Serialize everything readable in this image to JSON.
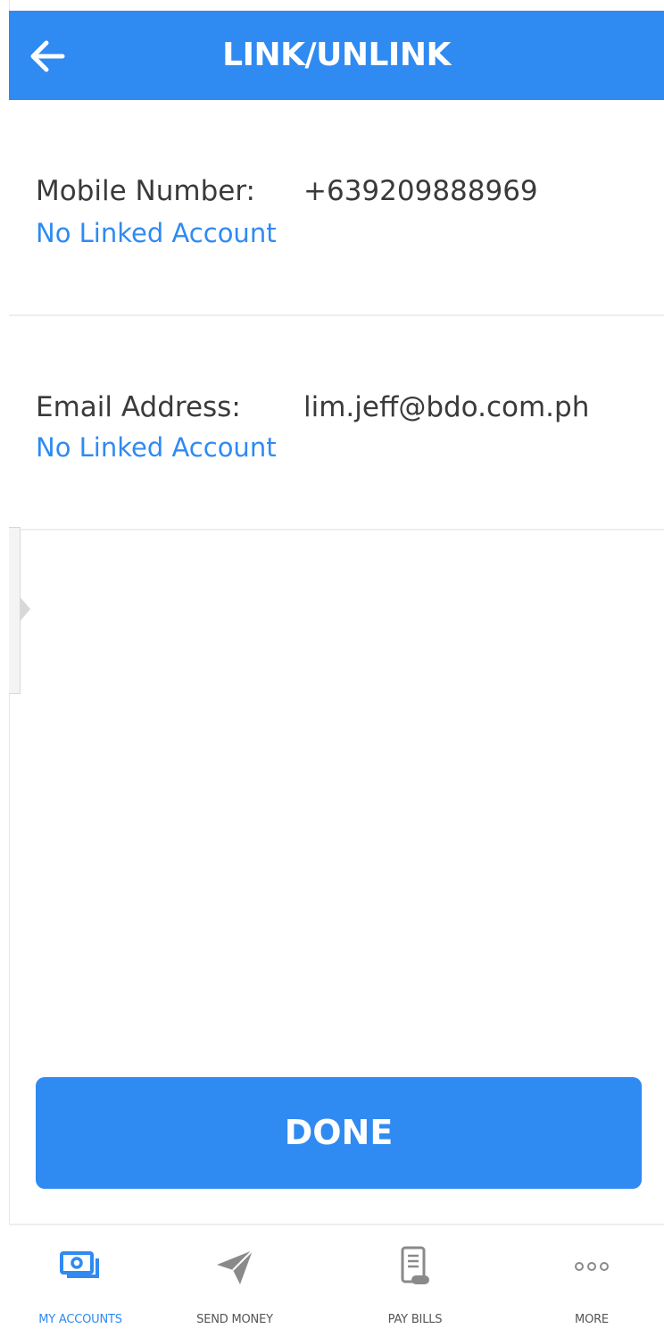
{
  "header": {
    "title": "LINK/UNLINK"
  },
  "mobile": {
    "label": "Mobile Number:",
    "value": "+639209888969",
    "status": "No Linked Account"
  },
  "email": {
    "label": "Email Address:",
    "value": "lim.jeff@bdo.com.ph",
    "status": "No Linked Account"
  },
  "done_button": {
    "label": "DONE"
  },
  "bottom_nav": {
    "items": [
      {
        "label": "MY ACCOUNTS",
        "icon": "accounts-icon",
        "active": true
      },
      {
        "label": "SEND MONEY",
        "icon": "paper-plane-icon",
        "active": false
      },
      {
        "label": "PAY BILLS",
        "icon": "bill-icon",
        "active": false
      },
      {
        "label": "MORE",
        "icon": "more-icon",
        "active": false
      }
    ]
  },
  "colors": {
    "primary": "#2f8af2",
    "text": "#3a3a3a",
    "nav_inactive": "#555555"
  }
}
